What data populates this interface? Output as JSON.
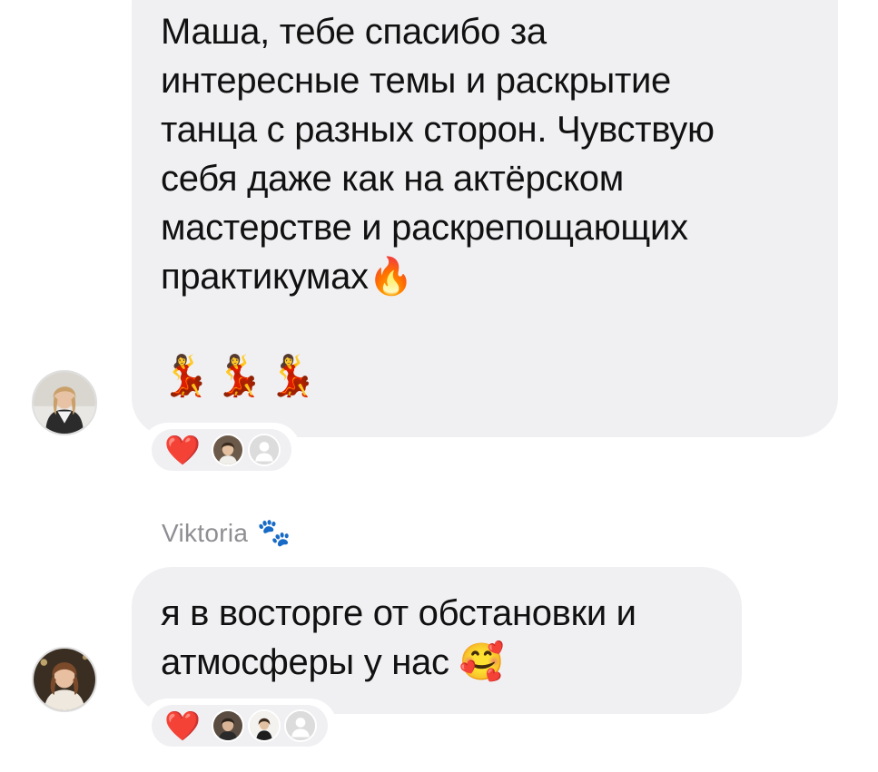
{
  "messages": [
    {
      "text": "Маша, тебе спасибо за\nинтересные темы и раскрытие\nтанца с разных сторон. Чувствую\nсебя даже как на актёрском\nмастерстве и раскрепощающих\nпрактикумах🔥",
      "emoji_line": "💃💃💃",
      "reaction": "❤️"
    },
    {
      "sender": "Viktoria",
      "sender_emoji": "🐾",
      "text": "я в восторге от обстановки и\nатмосферы у нас 🥰",
      "reaction": "❤️"
    }
  ],
  "colors": {
    "bubble": "#f0f0f3",
    "text": "#111111",
    "sender": "#8e8e93",
    "heart": "#e8132b"
  }
}
